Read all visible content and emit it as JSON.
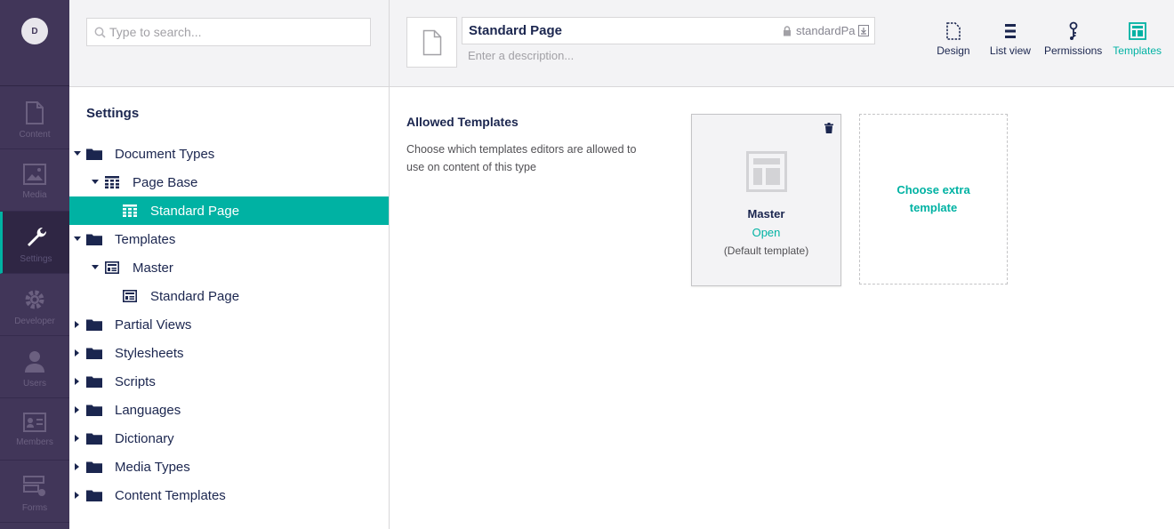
{
  "user": {
    "initial": "D"
  },
  "sections": [
    {
      "label": "Content",
      "icon": "document-icon"
    },
    {
      "label": "Media",
      "icon": "image-icon"
    },
    {
      "label": "Settings",
      "icon": "wrench-icon"
    },
    {
      "label": "Developer",
      "icon": "gear-icon"
    },
    {
      "label": "Users",
      "icon": "user-icon"
    },
    {
      "label": "Members",
      "icon": "id-card-icon"
    },
    {
      "label": "Forms",
      "icon": "form-icon"
    }
  ],
  "tree": {
    "search_placeholder": "Type to search...",
    "title": "Settings",
    "nodes": [
      {
        "label": "Document Types",
        "icon": "folder-icon",
        "caret": "expanded",
        "level": 0
      },
      {
        "label": "Page Base",
        "icon": "document-type-icon",
        "caret": "expanded",
        "level": 1
      },
      {
        "label": "Standard Page",
        "icon": "document-type-icon",
        "caret": "none",
        "level": 2,
        "selected": true
      },
      {
        "label": "Templates",
        "icon": "folder-icon",
        "caret": "expanded",
        "level": 0
      },
      {
        "label": "Master",
        "icon": "template-icon",
        "caret": "expanded",
        "level": 1
      },
      {
        "label": "Standard Page",
        "icon": "template-icon",
        "caret": "none",
        "level": 2
      },
      {
        "label": "Partial Views",
        "icon": "folder-icon",
        "caret": "collapsed",
        "level": 0
      },
      {
        "label": "Stylesheets",
        "icon": "folder-icon",
        "caret": "collapsed",
        "level": 0
      },
      {
        "label": "Scripts",
        "icon": "folder-icon",
        "caret": "collapsed",
        "level": 0
      },
      {
        "label": "Languages",
        "icon": "folder-icon",
        "caret": "collapsed",
        "level": 0
      },
      {
        "label": "Dictionary",
        "icon": "folder-icon",
        "caret": "collapsed",
        "level": 0
      },
      {
        "label": "Media Types",
        "icon": "folder-icon",
        "caret": "collapsed",
        "level": 0
      },
      {
        "label": "Content Templates",
        "icon": "folder-icon",
        "caret": "collapsed",
        "level": 0
      }
    ]
  },
  "editor": {
    "name": "Standard Page",
    "alias": "standardPa",
    "description_placeholder": "Enter a description...",
    "apps": [
      {
        "label": "Design",
        "icon": "document-outline-icon",
        "active": false
      },
      {
        "label": "List view",
        "icon": "list-icon",
        "active": false
      },
      {
        "label": "Permissions",
        "icon": "keychain-icon",
        "active": false
      },
      {
        "label": "Templates",
        "icon": "layout-icon",
        "active": true
      }
    ],
    "allowed_templates": {
      "label": "Allowed Templates",
      "description": "Choose which templates editors are allowed to use on content of this type",
      "template": {
        "name": "Master",
        "open_label": "Open",
        "default_label": "(Default template)"
      },
      "choose_label": "Choose extra template"
    }
  },
  "colors": {
    "rail": "#413659",
    "accent": "#00b2a3",
    "text": "#1b264f"
  }
}
